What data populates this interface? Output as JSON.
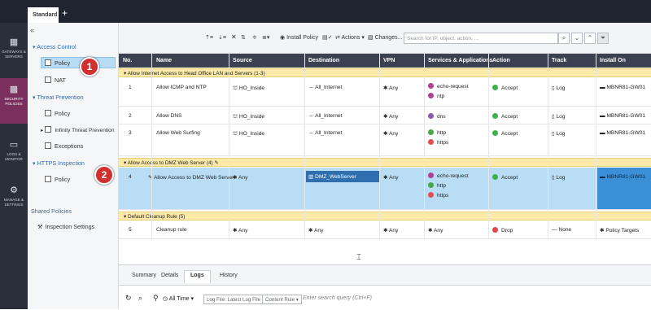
{
  "tabs": {
    "active_label": "Standard",
    "add_label": "+"
  },
  "leftnav": [
    {
      "label": "GATEWAYS & SERVERS",
      "icon": "grid-icon"
    },
    {
      "label": "SECURITY POLICIES",
      "icon": "shield-icon"
    },
    {
      "label": "LOGS & MONITOR",
      "icon": "monitor-icon"
    },
    {
      "label": "MANAGE & SETTINGS",
      "icon": "gear-icon"
    }
  ],
  "tree": {
    "collapse_glyph": "«",
    "access_control": "Access Control",
    "ac_policy": "Policy",
    "nat": "NAT",
    "threat_prevention": "Threat Prevention",
    "tp_policy": "Policy",
    "infinity": "Infinity Threat Prevention",
    "exceptions": "Exceptions",
    "https_inspection": "HTTPS Inspection",
    "hi_policy": "Policy",
    "shared_policies": "Shared Policies",
    "inspection_settings": "Inspection Settings"
  },
  "badges": {
    "one": "1",
    "two": "2"
  },
  "toolbar": {
    "install_policy": "Install Policy",
    "actions": "Actions",
    "changes": "Changes...",
    "search_placeholder": "Search for IP, object, action, ..."
  },
  "columns": {
    "no": "No.",
    "name": "Name",
    "source": "Source",
    "destination": "Destination",
    "vpn": "VPN",
    "services": "Services & Applications",
    "action": "Action",
    "track": "Track",
    "install_on": "Install On"
  },
  "sections": [
    "Allow Internet Access to Head Office LAN and Servers (1-3)",
    "Allow Access to DMZ Web Server (4)",
    "Default Cleanup Rule (5)"
  ],
  "rules": [
    {
      "no": "1",
      "name": "Allow ICMP and NTP",
      "source": "HO_Inside",
      "destination": "All_Internet",
      "vpn": "Any",
      "services": [
        "echo-request",
        "ntp"
      ],
      "action": "Accept",
      "track": "Log",
      "install_on": "MBNR81-GW01"
    },
    {
      "no": "2",
      "name": "Allow DNS",
      "source": "HO_Inside",
      "destination": "All_Internet",
      "vpn": "Any",
      "services": [
        "dns"
      ],
      "action": "Accept",
      "track": "Log",
      "install_on": "MBNR81-GW01"
    },
    {
      "no": "3",
      "name": "Allow Web Surfing",
      "source": "HO_Inside",
      "destination": "All_Internet",
      "vpn": "Any",
      "services": [
        "http",
        "https"
      ],
      "action": "Accept",
      "track": "Log",
      "install_on": "MBNR81-GW01"
    },
    {
      "no": "4",
      "name": "Allow Access to DMZ Web Server",
      "source": "Any",
      "destination": "DMZ_WebServer",
      "vpn": "Any",
      "services": [
        "echo-request",
        "http",
        "https"
      ],
      "action": "Accept",
      "track": "Log",
      "install_on": "MBNR81-GW01"
    },
    {
      "no": "5",
      "name": "Cleanup rule",
      "source": "Any",
      "destination": "Any",
      "vpn": "Any",
      "services": [
        "Any"
      ],
      "action": "Drop",
      "track": "None",
      "install_on": "Policy Targets"
    }
  ],
  "bottom": {
    "tabs": [
      "Summary",
      "Details",
      "Logs",
      "History"
    ],
    "all_time": "All Time",
    "log_file": "Log File: Latest Log File",
    "content_rule": "Content Rule",
    "query_placeholder": "Enter search query (Ctrl+F)"
  },
  "colors": {
    "accent_active_nav": "#7a2f5e",
    "section_yellow": "#fde9a8",
    "selected_row": "#b9ddf4",
    "accept_green": "#3bb34a",
    "drop_red": "#e04848"
  }
}
